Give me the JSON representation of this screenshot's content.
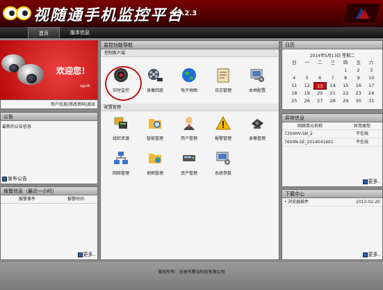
{
  "header": {
    "title": "视随通手机监控平台",
    "version": "V5.2.3"
  },
  "nav": {
    "tabs": [
      {
        "label": "首页"
      },
      {
        "label": "版本信息"
      }
    ]
  },
  "welcome": {
    "text": "欢迎您！",
    "user": "sgydk"
  },
  "user_links": {
    "info": "用户信息",
    "sep1": "|",
    "change_password": "修改密码",
    "sep2": "|",
    "logout": "退出"
  },
  "notice": {
    "title": "公告",
    "content": "最新的公告信息",
    "publish": "发布公告"
  },
  "alarm": {
    "title": "报警信息（最近一小时）",
    "col_event": "报警事件",
    "col_time": "报警时间",
    "more": "更多.."
  },
  "center": {
    "title": "监控功能导航",
    "section1": "控制客户端",
    "section2": "配置管理",
    "row1": [
      {
        "label": "实时监控"
      },
      {
        "label": "录像回放"
      },
      {
        "label": "电子地图"
      },
      {
        "label": "日志管理"
      },
      {
        "label": "本地配置"
      }
    ],
    "row2": [
      {
        "label": "组织资源"
      },
      {
        "label": "智能管理"
      },
      {
        "label": "用户管理"
      },
      {
        "label": "报警管理"
      },
      {
        "label": "录像管理"
      }
    ],
    "row3": [
      {
        "label": "网络管理"
      },
      {
        "label": "地图管理"
      },
      {
        "label": "资产管理"
      },
      {
        "label": "系统参数"
      }
    ]
  },
  "calendar": {
    "title": "日历",
    "date_line": "2014年5月13日  星期二",
    "weekdays": [
      "日",
      "一",
      "二",
      "三",
      "四",
      "五",
      "六"
    ],
    "weeks": [
      [
        "",
        "",
        "",
        "",
        "1",
        "2",
        "3"
      ],
      [
        "4",
        "5",
        "6",
        "7",
        "8",
        "9",
        "10"
      ],
      [
        "11",
        "12",
        "13",
        "14",
        "15",
        "16",
        "17"
      ],
      [
        "18",
        "19",
        "20",
        "21",
        "22",
        "23",
        "24"
      ],
      [
        "25",
        "26",
        "27",
        "28",
        "29",
        "30",
        "31"
      ]
    ],
    "today": "13"
  },
  "exceptions": {
    "title": "异常信息",
    "col_name": "网络单元名称",
    "col_type": "异常类型",
    "rows": [
      {
        "name": "7204HV-SN_2",
        "type": "不在线"
      },
      {
        "name": "7604N-SE_2014041601",
        "type": "不在线"
      }
    ],
    "more": "更多.."
  },
  "downloads": {
    "title": "下载中心",
    "rows": [
      {
        "name": "浏览器插件",
        "date": "2013-02-20"
      }
    ],
    "more": "更多.."
  },
  "footer": {
    "text": "版权所有：吉林市腾治科技有限公司"
  },
  "colors": {
    "header": "#5a0000",
    "accent": "#c41212",
    "panel": "#f4f4f4"
  }
}
